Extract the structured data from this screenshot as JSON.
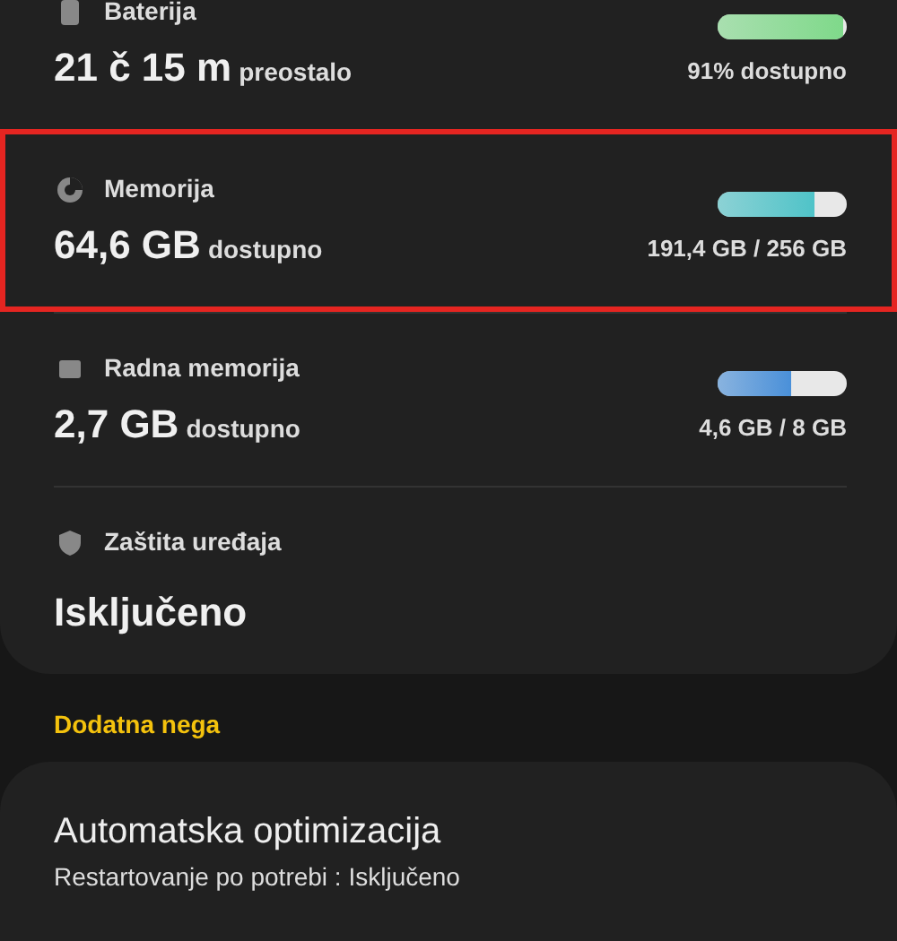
{
  "status_items": [
    {
      "kind": "meter",
      "title": "Baterija",
      "value": "21 č 15 m",
      "value_suffix": "preostalo",
      "level": 0.97,
      "color": "#7fd98a",
      "reading": "91% dostupno",
      "highlighted": false
    },
    {
      "kind": "meter",
      "title": "Memorija",
      "value": "64,6 GB",
      "value_suffix": "dostupno",
      "level": 0.75,
      "color": "#4fc3c8",
      "reading": "191,4 GB / 256 GB",
      "highlighted": true
    },
    {
      "kind": "meter",
      "title": "Radna memorija",
      "value": "2,7 GB",
      "value_suffix": "dostupno",
      "level": 0.57,
      "color": "#4a90d9",
      "reading": "4,6 GB / 8 GB",
      "highlighted": false
    },
    {
      "kind": "plain",
      "title": "Zaštita uređaja",
      "value": "Isključeno",
      "highlighted": false
    }
  ],
  "section_header": "Dodatna nega",
  "extra_items": [
    {
      "title": "Automatska optimizacija",
      "subtitle": "Restartovanje po potrebi : Isključeno"
    }
  ]
}
